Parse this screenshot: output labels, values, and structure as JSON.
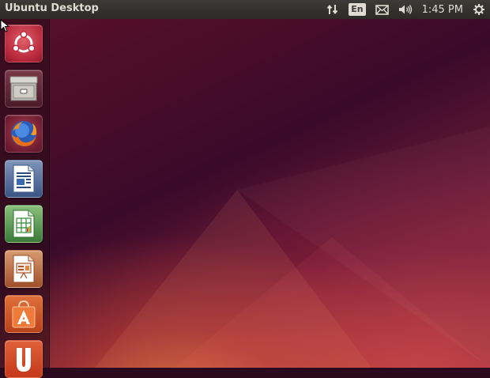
{
  "panel": {
    "title": "Ubuntu Desktop",
    "keyboard_layout": "En",
    "clock": "1:45 PM"
  },
  "indicators": [
    {
      "icon": "network-arrows-icon"
    },
    {
      "icon": "keyboard-layout-indicator"
    },
    {
      "icon": "envelope-icon"
    },
    {
      "icon": "volume-icon"
    },
    {
      "icon": "clock"
    },
    {
      "icon": "gear-icon"
    }
  ],
  "launcher": {
    "items": [
      {
        "name": "dash-home",
        "icon": "ubuntu-logo-icon"
      },
      {
        "name": "files",
        "icon": "file-cabinet-icon"
      },
      {
        "name": "firefox",
        "icon": "firefox-icon"
      },
      {
        "name": "libreoffice-writer",
        "icon": "writer-document-icon"
      },
      {
        "name": "libreoffice-calc",
        "icon": "calc-spreadsheet-icon"
      },
      {
        "name": "libreoffice-impress",
        "icon": "impress-presentation-icon"
      },
      {
        "name": "ubuntu-software-center",
        "icon": "software-center-bag-icon"
      },
      {
        "name": "ubuntu-one",
        "icon": "ubuntu-one-icon"
      }
    ]
  },
  "colors": {
    "panel": "#3c3b37",
    "panel_text": "#dfdbd2",
    "launcher_bg": "#2c0a1e",
    "ubuntu_orange": "#dd4814"
  }
}
